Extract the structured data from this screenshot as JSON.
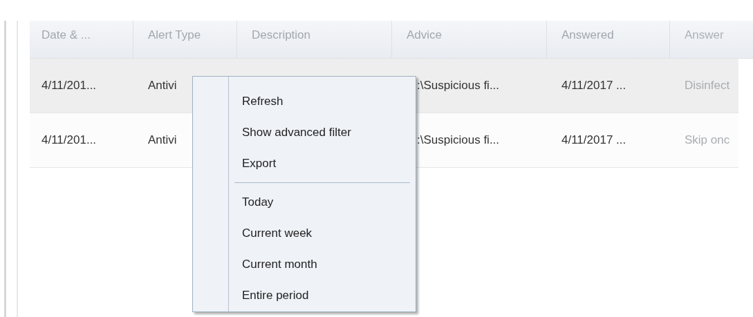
{
  "table": {
    "columns": [
      "Date & ...",
      "Alert Type",
      "Description",
      "Advice",
      "Answered",
      "Answer"
    ],
    "rows": [
      {
        "cells": [
          "4/11/201...",
          "Antivi",
          "",
          ":\\Suspicious fi...",
          "4/11/2017 ...",
          "Disinfect"
        ],
        "selected": true
      },
      {
        "cells": [
          "4/11/201...",
          "Antivi",
          "",
          ":\\Suspicious fi...",
          "4/11/2017 ...",
          "Skip onc"
        ],
        "selected": false
      }
    ]
  },
  "context_menu": {
    "groups": [
      [
        "Refresh",
        "Show advanced filter",
        "Export"
      ],
      [
        "Today",
        "Current week",
        "Current month",
        "Entire period"
      ]
    ]
  }
}
